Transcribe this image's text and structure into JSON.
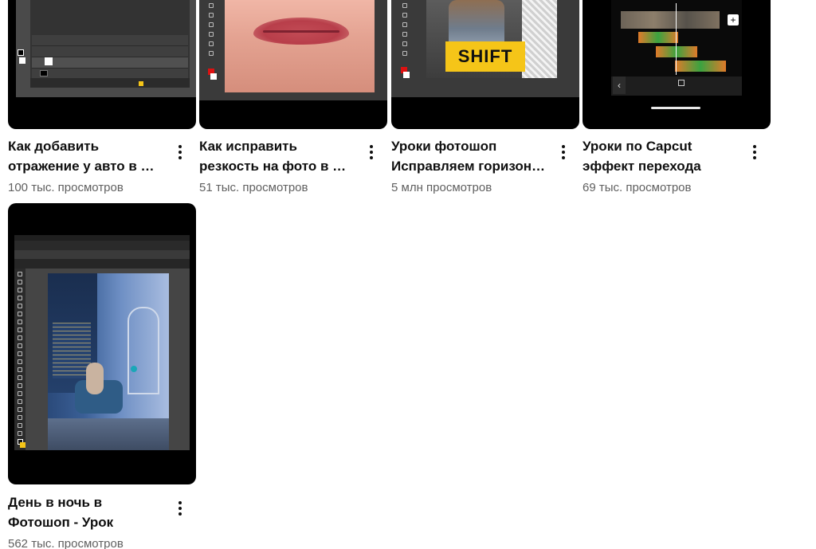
{
  "videos": [
    {
      "title": "Как добавить отражение у авто в …",
      "title_line1": "Как добавить",
      "title_line2": "отражение у авто в …",
      "views": "100 тыс. просмотров"
    },
    {
      "title": "Как исправить резкость на фото в …",
      "title_line1": "Как исправить",
      "title_line2": "резкость на фото в …",
      "views": "51 тыс. просмотров"
    },
    {
      "title": "Уроки фотошоп Исправляем горизон…",
      "title_line1": "Уроки фотошоп",
      "title_line2": "Исправляем горизон…",
      "views": "5 млн просмотров",
      "thumb_text": "SHIFT"
    },
    {
      "title": "Уроки по Capcut эффект перехода",
      "title_line1": "Уроки по Capcut",
      "title_line2": "эффект перехода",
      "views": "69 тыс. просмотров"
    },
    {
      "title": "День в ночь в Фотошоп - Урок",
      "title_line1": "День в ночь в",
      "title_line2": "Фотошоп - Урок",
      "views": "562 тыс. просмотров"
    }
  ],
  "icons": {
    "more": "more-vert-icon"
  }
}
